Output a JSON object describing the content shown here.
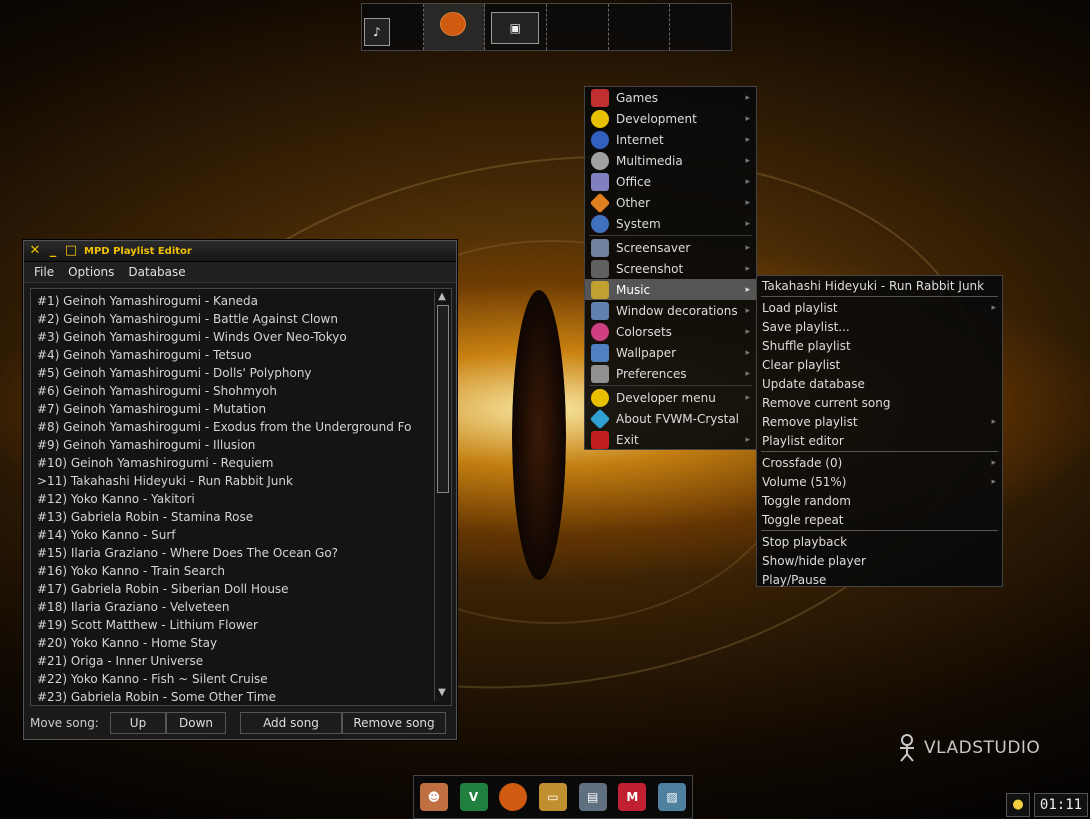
{
  "playlist_window": {
    "title": "MPD Playlist Editor",
    "menus": [
      "File",
      "Options",
      "Database"
    ],
    "songs": [
      "#1) Geinoh Yamashirogumi - Kaneda",
      "#2) Geinoh Yamashirogumi - Battle Against Clown",
      "#3) Geinoh Yamashirogumi - Winds Over Neo-Tokyo",
      "#4) Geinoh Yamashirogumi - Tetsuo",
      "#5) Geinoh Yamashirogumi - Dolls' Polyphony",
      "#6) Geinoh Yamashirogumi - Shohmyoh",
      "#7) Geinoh Yamashirogumi - Mutation",
      "#8) Geinoh Yamashirogumi - Exodus from the Underground Fo",
      "#9) Geinoh Yamashirogumi - Illusion",
      "#10) Geinoh Yamashirogumi - Requiem",
      ">11) Takahashi Hideyuki - Run Rabbit Junk",
      "#12) Yoko Kanno - Yakitori",
      "#13) Gabriela Robin - Stamina Rose",
      "#14) Yoko Kanno - Surf",
      "#15) Ilaria Graziano - Where Does The Ocean Go?",
      "#16) Yoko Kanno - Train Search",
      "#17) Gabriela Robin - Siberian Doll House",
      "#18) Ilaria Graziano - Velveteen",
      "#19) Scott Matthew - Lithium Flower",
      "#20) Yoko Kanno - Home Stay",
      "#21) Origa - Inner Universe",
      "#22) Yoko Kanno - Fish ~ Silent Cruise",
      "#23) Gabriela Robin - Some Other Time"
    ],
    "move_label": "Move song:",
    "up_label": "Up",
    "down_label": "Down",
    "add_label": "Add song",
    "remove_label": "Remove song"
  },
  "root_menu": {
    "items": [
      {
        "label": "Games",
        "icon": "games-icon",
        "color": "#c03030"
      },
      {
        "label": "Development",
        "icon": "development-icon",
        "color": "#e8c000"
      },
      {
        "label": "Internet",
        "icon": "internet-icon",
        "color": "#3060c0"
      },
      {
        "label": "Multimedia",
        "icon": "multimedia-icon",
        "color": "#a0a0a0"
      },
      {
        "label": "Office",
        "icon": "office-icon",
        "color": "#8080c0"
      },
      {
        "label": "Other",
        "icon": "other-icon",
        "color": "#e08020"
      },
      {
        "label": "System",
        "icon": "system-icon",
        "color": "#4070c0"
      },
      {
        "label": "Screensaver",
        "icon": "screensaver-icon",
        "color": "#7080a0"
      },
      {
        "label": "Screenshot",
        "icon": "screenshot-icon",
        "color": "#606060"
      },
      {
        "label": "Music",
        "icon": "music-icon",
        "color": "#c0a030"
      },
      {
        "label": "Window decorations",
        "icon": "window-decorations-icon",
        "color": "#6080b0"
      },
      {
        "label": "Colorsets",
        "icon": "colorsets-icon",
        "color": "#d04080"
      },
      {
        "label": "Wallpaper",
        "icon": "wallpaper-icon",
        "color": "#5080c0"
      },
      {
        "label": "Preferences",
        "icon": "preferences-icon",
        "color": "#909090"
      },
      {
        "label": "Developer menu",
        "icon": "developer-menu-icon",
        "color": "#e8c000"
      },
      {
        "label": "About FVWM-Crystal",
        "icon": "about-icon",
        "color": "#30a0d0"
      },
      {
        "label": "Exit",
        "icon": "exit-icon",
        "color": "#c02020"
      }
    ]
  },
  "music_menu": {
    "items": [
      "Takahashi Hideyuki - Run Rabbit Junk",
      "Load playlist",
      "Save playlist...",
      "Shuffle playlist",
      "Clear playlist",
      "Update database",
      "Remove current song",
      "Remove playlist",
      "Playlist editor",
      "Crossfade (0)",
      "Volume (51%)",
      "Toggle random",
      "Toggle repeat",
      "Stop playback",
      "Show/hide player",
      "Play/Pause"
    ]
  },
  "wallpaper": {
    "brand": "VLADSTUDIO"
  },
  "tray": {
    "clock": "01:11"
  }
}
